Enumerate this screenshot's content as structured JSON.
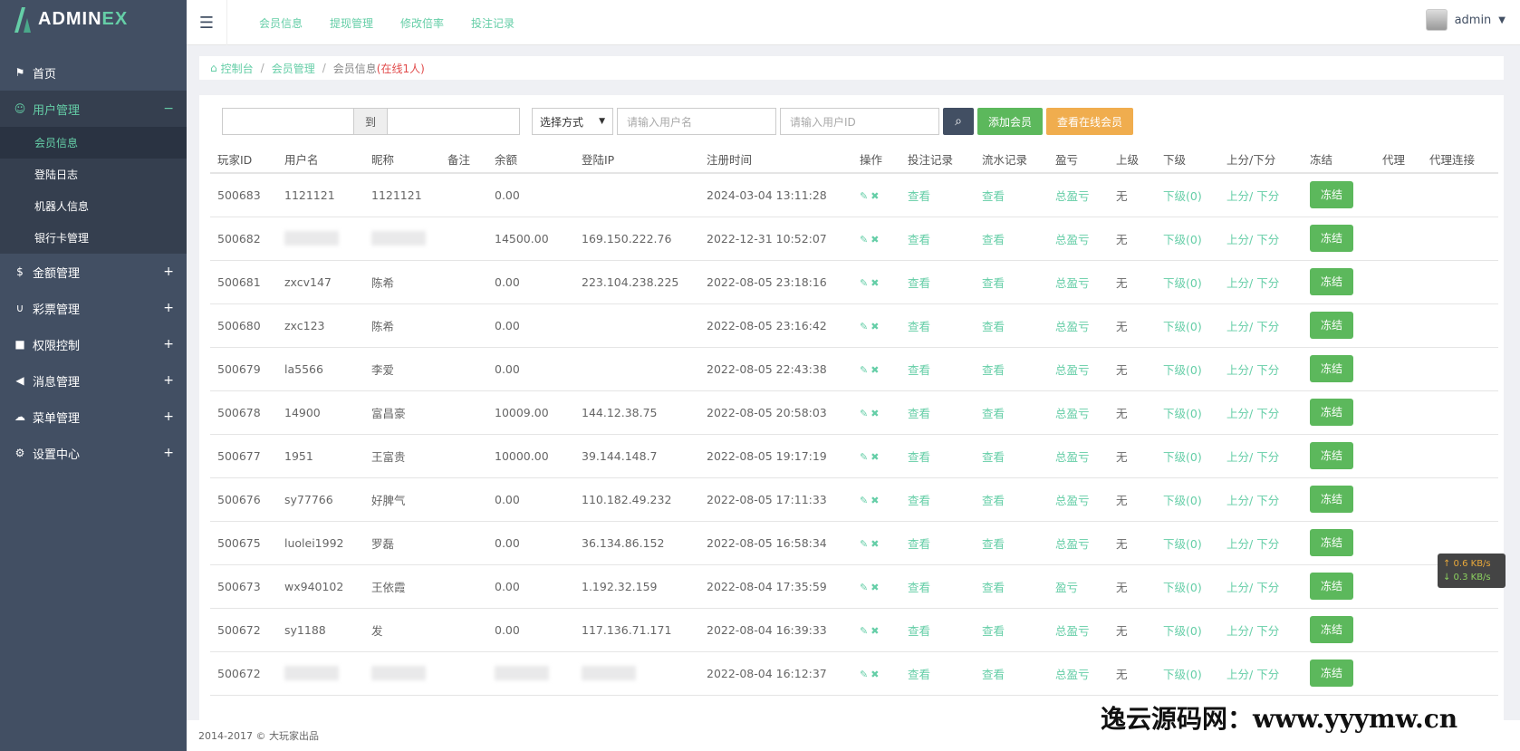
{
  "app": {
    "logo_main": "ADMIN",
    "logo_accent": "EX"
  },
  "sidebar": {
    "items": [
      {
        "label": "首页",
        "icon": "flag-icon"
      },
      {
        "label": "用户管理",
        "icon": "gear-small-icon",
        "toggle": "−"
      },
      {
        "label": "金额管理",
        "icon": "dollar-icon",
        "toggle": "+"
      },
      {
        "label": "彩票管理",
        "icon": "magnet-icon",
        "toggle": "+"
      },
      {
        "label": "权限控制",
        "icon": "lock-icon",
        "toggle": "+"
      },
      {
        "label": "消息管理",
        "icon": "bullhorn-icon",
        "toggle": "+"
      },
      {
        "label": "菜单管理",
        "icon": "cloud-icon",
        "toggle": "+"
      },
      {
        "label": "设置中心",
        "icon": "cog-icon",
        "toggle": "+"
      }
    ],
    "subitems": [
      "会员信息",
      "登陆日志",
      "机器人信息",
      "银行卡管理"
    ]
  },
  "header": {
    "links": [
      "会员信息",
      "提现管理",
      "修改倍率",
      "投注记录"
    ],
    "username": "admin"
  },
  "breadcrumb": {
    "home": "控制台",
    "level2": "会员管理",
    "current": "会员信息",
    "online": "(在线1人)"
  },
  "filters": {
    "to_label": "到",
    "select_label": "选择方式",
    "username_placeholder": "请输入用户名",
    "userid_placeholder": "请输入用户ID",
    "add_button": "添加会员",
    "online_button": "查看在线会员"
  },
  "table": {
    "headers": [
      "玩家ID",
      "用户名",
      "昵称",
      "备注",
      "余额",
      "登陆IP",
      "注册时间",
      "操作",
      "投注记录",
      "流水记录",
      "盈亏",
      "上级",
      "下级",
      "上分/下分",
      "冻结",
      "代理",
      "代理连接"
    ],
    "rows": [
      {
        "id": "500683",
        "username": "1121121",
        "nickname": "1121121",
        "balance": "0.00",
        "ip": "",
        "reg": "2024-03-04 13:11:28",
        "bet": "查看",
        "flow": "查看",
        "pl": "总盈亏",
        "parent": "无",
        "child": "下级(0)",
        "up": "上分",
        "down": "下分",
        "freeze": "冻结"
      },
      {
        "id": "500682",
        "username": "",
        "nickname": "",
        "balance": "14500.00",
        "ip": "169.150.222.76",
        "reg": "2022-12-31 10:52:07",
        "bet": "查看",
        "flow": "查看",
        "pl": "总盈亏",
        "parent": "无",
        "child": "下级(0)",
        "up": "上分",
        "down": "下分",
        "freeze": "冻结"
      },
      {
        "id": "500681",
        "username": "zxcv147",
        "nickname": "陈希",
        "balance": "0.00",
        "ip": "223.104.238.225",
        "reg": "2022-08-05 23:18:16",
        "bet": "查看",
        "flow": "查看",
        "pl": "总盈亏",
        "parent": "无",
        "child": "下级(0)",
        "up": "上分",
        "down": "下分",
        "freeze": "冻结"
      },
      {
        "id": "500680",
        "username": "zxc123",
        "nickname": "陈希",
        "balance": "0.00",
        "ip": "",
        "reg": "2022-08-05 23:16:42",
        "bet": "查看",
        "flow": "查看",
        "pl": "总盈亏",
        "parent": "无",
        "child": "下级(0)",
        "up": "上分",
        "down": "下分",
        "freeze": "冻结"
      },
      {
        "id": "500679",
        "username": "la5566",
        "nickname": "李爱",
        "balance": "0.00",
        "ip": "",
        "reg": "2022-08-05 22:43:38",
        "bet": "查看",
        "flow": "查看",
        "pl": "总盈亏",
        "parent": "无",
        "child": "下级(0)",
        "up": "上分",
        "down": "下分",
        "freeze": "冻结"
      },
      {
        "id": "500678",
        "username": "14900",
        "nickname": "富昌豪",
        "balance": "10009.00",
        "ip": "144.12.38.75",
        "reg": "2022-08-05 20:58:03",
        "bet": "查看",
        "flow": "查看",
        "pl": "总盈亏",
        "parent": "无",
        "child": "下级(0)",
        "up": "上分",
        "down": "下分",
        "freeze": "冻结"
      },
      {
        "id": "500677",
        "username": "1951",
        "nickname": "王富贵",
        "balance": "10000.00",
        "ip": "39.144.148.7",
        "reg": "2022-08-05 19:17:19",
        "bet": "查看",
        "flow": "查看",
        "pl": "总盈亏",
        "parent": "无",
        "child": "下级(0)",
        "up": "上分",
        "down": "下分",
        "freeze": "冻结"
      },
      {
        "id": "500676",
        "username": "sy77766",
        "nickname": "好脾气",
        "balance": "0.00",
        "ip": "110.182.49.232",
        "reg": "2022-08-05 17:11:33",
        "bet": "查看",
        "flow": "查看",
        "pl": "总盈亏",
        "parent": "无",
        "child": "下级(0)",
        "up": "上分",
        "down": "下分",
        "freeze": "冻结"
      },
      {
        "id": "500675",
        "username": "luolei1992",
        "nickname": "罗磊",
        "balance": "0.00",
        "ip": "36.134.86.152",
        "reg": "2022-08-05 16:58:34",
        "bet": "查看",
        "flow": "查看",
        "pl": "总盈亏",
        "parent": "无",
        "child": "下级(0)",
        "up": "上分",
        "down": "下分",
        "freeze": "冻结"
      },
      {
        "id": "500673",
        "username": "wx940102",
        "nickname": "王依霞",
        "balance": "0.00",
        "ip": "1.192.32.159",
        "reg": "2022-08-04 17:35:59",
        "bet": "查看",
        "flow": "查看",
        "pl": "盈亏",
        "parent": "无",
        "child": "下级(0)",
        "up": "上分",
        "down": "下分",
        "freeze": "冻结"
      },
      {
        "id": "500672",
        "username": "sy1188",
        "nickname": "发",
        "balance": "0.00",
        "ip": "117.136.71.171",
        "reg": "2022-08-04 16:39:33",
        "bet": "查看",
        "flow": "查看",
        "pl": "总盈亏",
        "parent": "无",
        "child": "下级(0)",
        "up": "上分",
        "down": "下分",
        "freeze": "冻结"
      },
      {
        "id": "500672",
        "username": "",
        "nickname": "",
        "balance": "",
        "ip": "",
        "reg": "2022-08-04 16:12:37",
        "bet": "查看",
        "flow": "查看",
        "pl": "总盈亏",
        "parent": "无",
        "child": "下级(0)",
        "up": "上分",
        "down": "下分",
        "freeze": "冻结"
      }
    ]
  },
  "footer": {
    "text": "2014-2017 © 大玩家出品"
  },
  "netspeed": {
    "up": "↑ 0.6 KB/s",
    "down": "↓ 0.3 KB/s"
  },
  "watermark": "逸云源码网：www.yyymw.cn",
  "colors": {
    "accent": "#65cea7",
    "sidebar": "#424f63",
    "success": "#5cb85c",
    "warning": "#f0ad4e",
    "danger": "#e14b4b",
    "dark_button": "#424f63"
  }
}
